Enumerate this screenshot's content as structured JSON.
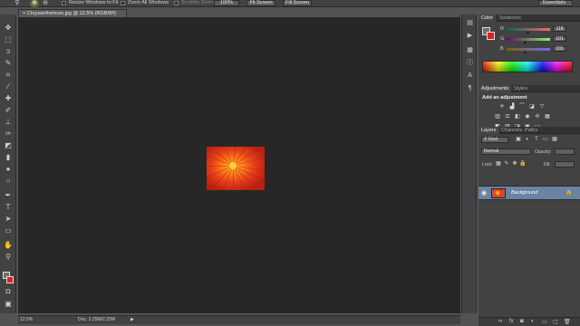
{
  "options_bar": {
    "resize_windows_label": "Resize Windows to Fit",
    "zoom_all_label": "Zoom All Windows",
    "scrubby_zoom_label": "Scrubby Zoom",
    "btn_100": "100%",
    "fit_screen": "Fit Screen",
    "fill_screen": "Fill Screen",
    "workspace": "Essentials"
  },
  "document": {
    "tab_title": "Chrysanthemum.jpg @ 12.5% (RGB/8#)",
    "status_zoom": "12.5%",
    "status_doc": "Doc: 2.25M/2.25M",
    "status_arrow": "▶"
  },
  "color_panel": {
    "tabs": [
      "Color",
      "Swatches"
    ],
    "sliders": [
      {
        "label": "R",
        "value": "118"
      },
      {
        "label": "G",
        "value": "101"
      },
      {
        "label": "B",
        "value": "101"
      }
    ],
    "foreground": "#707070",
    "background": "#e21d1d"
  },
  "adjustments_panel": {
    "tabs": [
      "Adjustments",
      "Styles"
    ],
    "title": "Add an adjustment"
  },
  "layers_panel": {
    "tabs": [
      "Layers",
      "Channels",
      "Paths"
    ],
    "kind_label": "Kind",
    "blend_mode": "Normal",
    "opacity_label": "Opacity:",
    "lock_label": "Lock:",
    "fill_label": "Fill:",
    "layer_name": "Background"
  },
  "icons": {
    "tools": [
      "move-icon",
      "marquee-icon",
      "lasso-icon",
      "quick-select-icon",
      "crop-icon",
      "eyedropper-icon",
      "healing-brush-icon",
      "brush-icon",
      "clone-stamp-icon",
      "history-brush-icon",
      "eraser-icon",
      "gradient-icon",
      "blur-icon",
      "dodge-icon",
      "pen-icon",
      "type-icon",
      "path-select-icon",
      "shape-icon",
      "hand-icon",
      "zoom-icon"
    ]
  }
}
